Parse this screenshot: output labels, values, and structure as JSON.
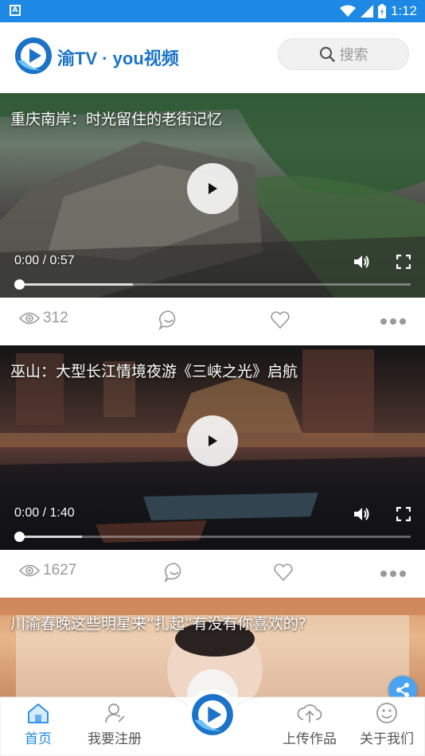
{
  "status_bar": {
    "left_icon_letter": "A",
    "time": "1:12"
  },
  "header": {
    "app_name": "渝TV · you视频",
    "search_label": "搜索"
  },
  "videos": [
    {
      "title": "重庆南岸：时光留住的老街记忆",
      "time": "0:00 / 0:57",
      "progress": 0.29,
      "views": "312"
    },
    {
      "title": "巫山：大型长江情境夜游《三峡之光》启航",
      "time": "0:00 / 1:40",
      "progress": 0.16,
      "views": "1627"
    },
    {
      "title": "川渝春晚这些明星来“扎起”有没有你喜欢的?"
    }
  ],
  "bottom_nav": {
    "items": [
      {
        "label": "首页",
        "icon": "home-icon",
        "active": true
      },
      {
        "label": "我要注册",
        "icon": "register-icon",
        "active": false
      },
      {
        "label": "上传作品",
        "icon": "upload-icon",
        "active": false
      },
      {
        "label": "关于我们",
        "icon": "smile-icon",
        "active": false
      }
    ]
  },
  "colors": {
    "accent": "#1e88e5",
    "icon_gray": "#9a9a9a"
  }
}
